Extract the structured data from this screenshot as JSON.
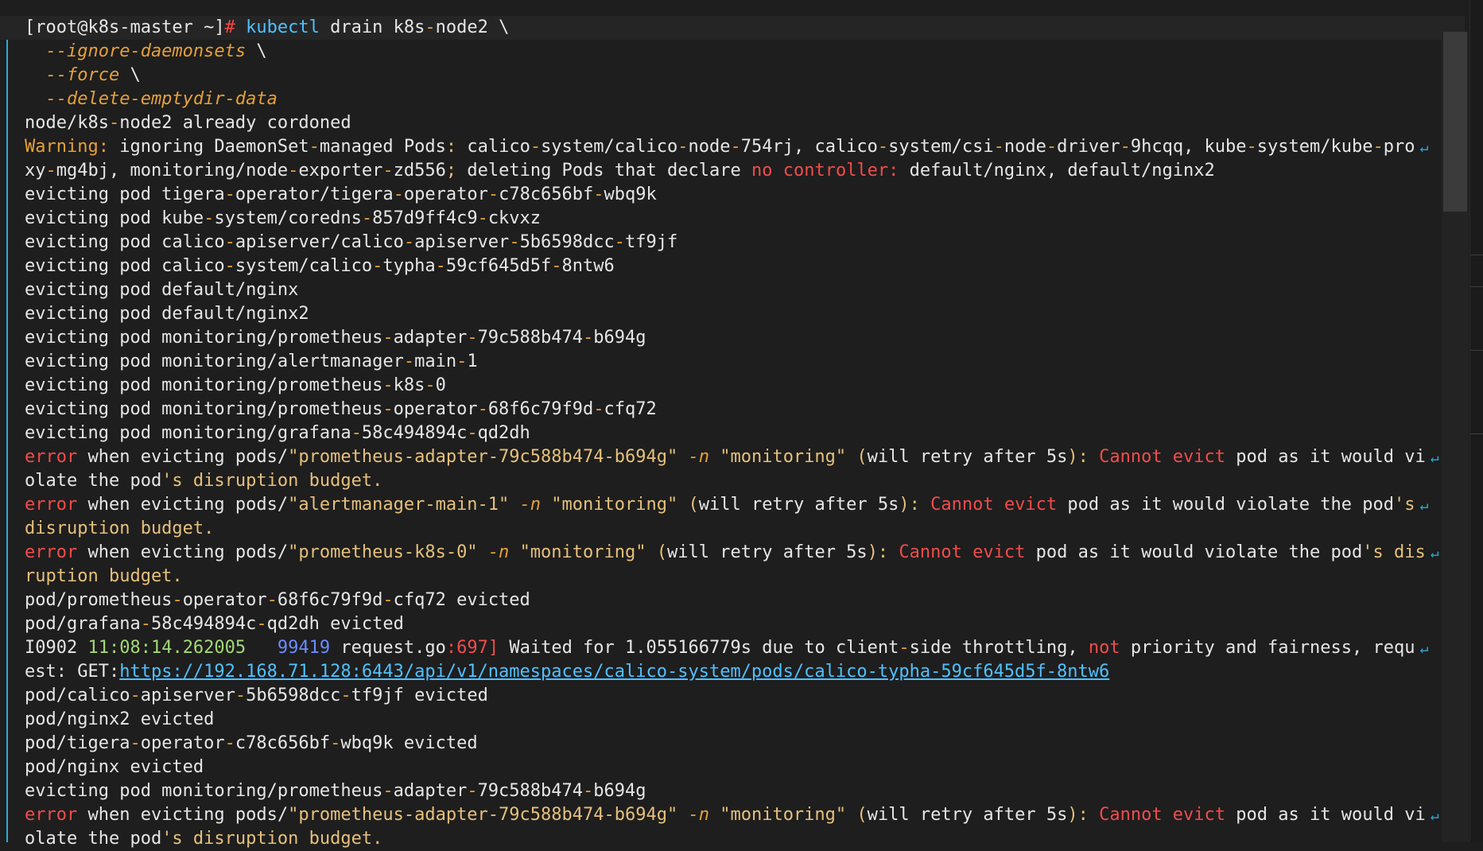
{
  "terminal": {
    "lines": [
      {
        "hl": true,
        "segs": [
          {
            "t": "[root@k8s-master ~]",
            "c": "prompt"
          },
          {
            "t": "# ",
            "c": "hash"
          },
          {
            "t": "kubectl",
            "c": "cmd"
          },
          {
            "t": " drain k8s",
            "c": ""
          },
          {
            "t": "-",
            "c": "dash"
          },
          {
            "t": "node2 \\",
            "c": ""
          }
        ]
      },
      {
        "segs": [
          {
            "t": "  --ignore-daemonsets",
            "c": "flag"
          },
          {
            "t": " \\",
            "c": ""
          }
        ]
      },
      {
        "segs": [
          {
            "t": "  --force",
            "c": "flag"
          },
          {
            "t": " \\",
            "c": ""
          }
        ]
      },
      {
        "segs": [
          {
            "t": "  --delete-emptydir-data",
            "c": "flag"
          }
        ]
      },
      {
        "segs": [
          {
            "t": "node/k8s",
            "c": ""
          },
          {
            "t": "-",
            "c": "dash"
          },
          {
            "t": "node2 already cordoned",
            "c": ""
          }
        ]
      },
      {
        "wrap": true,
        "segs": [
          {
            "t": "Warning:",
            "c": "warn"
          },
          {
            "t": " ignoring DaemonSet",
            "c": ""
          },
          {
            "t": "-",
            "c": "dash"
          },
          {
            "t": "managed Pods",
            "c": ""
          },
          {
            "t": ":",
            "c": "yellow"
          },
          {
            "t": " calico",
            "c": ""
          },
          {
            "t": "-",
            "c": "dash"
          },
          {
            "t": "system/calico",
            "c": ""
          },
          {
            "t": "-",
            "c": "dash"
          },
          {
            "t": "node",
            "c": ""
          },
          {
            "t": "-",
            "c": "dash"
          },
          {
            "t": "754rj, calico",
            "c": ""
          },
          {
            "t": "-",
            "c": "dash"
          },
          {
            "t": "system/csi",
            "c": ""
          },
          {
            "t": "-",
            "c": "dash"
          },
          {
            "t": "node",
            "c": ""
          },
          {
            "t": "-",
            "c": "dash"
          },
          {
            "t": "driver",
            "c": ""
          },
          {
            "t": "-",
            "c": "dash"
          },
          {
            "t": "9hcqq, kube",
            "c": ""
          },
          {
            "t": "-",
            "c": "dash"
          },
          {
            "t": "system/kube",
            "c": ""
          },
          {
            "t": "-",
            "c": "dash"
          },
          {
            "t": "pro",
            "c": ""
          }
        ]
      },
      {
        "segs": [
          {
            "t": "xy",
            "c": ""
          },
          {
            "t": "-",
            "c": "dash"
          },
          {
            "t": "mg4bj, monitoring/node",
            "c": ""
          },
          {
            "t": "-",
            "c": "dash"
          },
          {
            "t": "exporter",
            "c": ""
          },
          {
            "t": "-",
            "c": "dash"
          },
          {
            "t": "zd556",
            "c": ""
          },
          {
            "t": ";",
            "c": "yellow"
          },
          {
            "t": " deleting Pods that declare ",
            "c": ""
          },
          {
            "t": "no controller:",
            "c": "red"
          },
          {
            "t": " default/nginx, default/nginx2",
            "c": ""
          }
        ]
      },
      {
        "segs": [
          {
            "t": "evicting pod tigera",
            "c": ""
          },
          {
            "t": "-",
            "c": "dash"
          },
          {
            "t": "operator/tigera",
            "c": ""
          },
          {
            "t": "-",
            "c": "dash"
          },
          {
            "t": "operator",
            "c": ""
          },
          {
            "t": "-",
            "c": "dash"
          },
          {
            "t": "c78c656bf",
            "c": ""
          },
          {
            "t": "-",
            "c": "dash"
          },
          {
            "t": "wbq9k",
            "c": ""
          }
        ]
      },
      {
        "segs": [
          {
            "t": "evicting pod kube",
            "c": ""
          },
          {
            "t": "-",
            "c": "dash"
          },
          {
            "t": "system/coredns",
            "c": ""
          },
          {
            "t": "-",
            "c": "dash"
          },
          {
            "t": "857d9ff4c9",
            "c": ""
          },
          {
            "t": "-",
            "c": "dash"
          },
          {
            "t": "ckvxz",
            "c": ""
          }
        ]
      },
      {
        "segs": [
          {
            "t": "evicting pod calico",
            "c": ""
          },
          {
            "t": "-",
            "c": "dash"
          },
          {
            "t": "apiserver/calico",
            "c": ""
          },
          {
            "t": "-",
            "c": "dash"
          },
          {
            "t": "apiserver",
            "c": ""
          },
          {
            "t": "-",
            "c": "dash"
          },
          {
            "t": "5b6598dcc",
            "c": ""
          },
          {
            "t": "-",
            "c": "dash"
          },
          {
            "t": "tf9jf",
            "c": ""
          }
        ]
      },
      {
        "segs": [
          {
            "t": "evicting pod calico",
            "c": ""
          },
          {
            "t": "-",
            "c": "dash"
          },
          {
            "t": "system/calico",
            "c": ""
          },
          {
            "t": "-",
            "c": "dash"
          },
          {
            "t": "typha",
            "c": ""
          },
          {
            "t": "-",
            "c": "dash"
          },
          {
            "t": "59cf645d5f",
            "c": ""
          },
          {
            "t": "-",
            "c": "dash"
          },
          {
            "t": "8ntw6",
            "c": ""
          }
        ]
      },
      {
        "segs": [
          {
            "t": "evicting pod default/nginx",
            "c": ""
          }
        ]
      },
      {
        "segs": [
          {
            "t": "evicting pod default/nginx2",
            "c": ""
          }
        ]
      },
      {
        "segs": [
          {
            "t": "evicting pod monitoring/prometheus",
            "c": ""
          },
          {
            "t": "-",
            "c": "dash"
          },
          {
            "t": "adapter",
            "c": ""
          },
          {
            "t": "-",
            "c": "dash"
          },
          {
            "t": "79c588b474",
            "c": ""
          },
          {
            "t": "-",
            "c": "dash"
          },
          {
            "t": "b694g",
            "c": ""
          }
        ]
      },
      {
        "segs": [
          {
            "t": "evicting pod monitoring/alertmanager",
            "c": ""
          },
          {
            "t": "-",
            "c": "dash"
          },
          {
            "t": "main",
            "c": ""
          },
          {
            "t": "-",
            "c": "dash"
          },
          {
            "t": "1",
            "c": ""
          }
        ]
      },
      {
        "segs": [
          {
            "t": "evicting pod monitoring/prometheus",
            "c": ""
          },
          {
            "t": "-",
            "c": "dash"
          },
          {
            "t": "k8s",
            "c": ""
          },
          {
            "t": "-",
            "c": "dash"
          },
          {
            "t": "0",
            "c": ""
          }
        ]
      },
      {
        "segs": [
          {
            "t": "evicting pod monitoring/prometheus",
            "c": ""
          },
          {
            "t": "-",
            "c": "dash"
          },
          {
            "t": "operator",
            "c": ""
          },
          {
            "t": "-",
            "c": "dash"
          },
          {
            "t": "68f6c79f9d",
            "c": ""
          },
          {
            "t": "-",
            "c": "dash"
          },
          {
            "t": "cfq72",
            "c": ""
          }
        ]
      },
      {
        "segs": [
          {
            "t": "evicting pod monitoring/grafana",
            "c": ""
          },
          {
            "t": "-",
            "c": "dash"
          },
          {
            "t": "58c494894c",
            "c": ""
          },
          {
            "t": "-",
            "c": "dash"
          },
          {
            "t": "qd2dh",
            "c": ""
          }
        ]
      },
      {
        "wrap": true,
        "segs": [
          {
            "t": "error",
            "c": "red"
          },
          {
            "t": " when evicting pods/",
            "c": ""
          },
          {
            "t": "\"prometheus-adapter-79c588b474-b694g\"",
            "c": "yellow"
          },
          {
            "t": " ",
            "c": ""
          },
          {
            "t": "-n",
            "c": "flag"
          },
          {
            "t": " ",
            "c": ""
          },
          {
            "t": "\"monitoring\"",
            "c": "yellow"
          },
          {
            "t": " ",
            "c": ""
          },
          {
            "t": "(",
            "c": "yellow"
          },
          {
            "t": "will retry after 5s",
            "c": ""
          },
          {
            "t": "):",
            "c": "yellow"
          },
          {
            "t": " Cannot evict",
            "c": "red"
          },
          {
            "t": " pod as it would vi",
            "c": ""
          }
        ]
      },
      {
        "segs": [
          {
            "t": "olate the pod",
            "c": ""
          },
          {
            "t": "'s disruption budget.",
            "c": "yellow"
          }
        ]
      },
      {
        "wrap": true,
        "segs": [
          {
            "t": "error",
            "c": "red"
          },
          {
            "t": " when evicting pods/",
            "c": ""
          },
          {
            "t": "\"alertmanager-main-1\"",
            "c": "yellow"
          },
          {
            "t": " ",
            "c": ""
          },
          {
            "t": "-n",
            "c": "flag"
          },
          {
            "t": " ",
            "c": ""
          },
          {
            "t": "\"monitoring\"",
            "c": "yellow"
          },
          {
            "t": " ",
            "c": ""
          },
          {
            "t": "(",
            "c": "yellow"
          },
          {
            "t": "will retry after 5s",
            "c": ""
          },
          {
            "t": "):",
            "c": "yellow"
          },
          {
            "t": " Cannot evict",
            "c": "red"
          },
          {
            "t": " pod as it would violate the pod",
            "c": ""
          },
          {
            "t": "'s",
            "c": "yellow"
          }
        ]
      },
      {
        "segs": [
          {
            "t": "disruption budget.",
            "c": "yellow"
          }
        ]
      },
      {
        "wrap": true,
        "segs": [
          {
            "t": "error",
            "c": "red"
          },
          {
            "t": " when evicting pods/",
            "c": ""
          },
          {
            "t": "\"prometheus-k8s-0\"",
            "c": "yellow"
          },
          {
            "t": " ",
            "c": ""
          },
          {
            "t": "-n",
            "c": "flag"
          },
          {
            "t": " ",
            "c": ""
          },
          {
            "t": "\"monitoring\"",
            "c": "yellow"
          },
          {
            "t": " ",
            "c": ""
          },
          {
            "t": "(",
            "c": "yellow"
          },
          {
            "t": "will retry after 5s",
            "c": ""
          },
          {
            "t": "):",
            "c": "yellow"
          },
          {
            "t": " Cannot evict",
            "c": "red"
          },
          {
            "t": " pod as it would violate the pod",
            "c": ""
          },
          {
            "t": "'s dis",
            "c": "yellow"
          }
        ]
      },
      {
        "segs": [
          {
            "t": "ruption budget.",
            "c": "yellow"
          }
        ]
      },
      {
        "segs": [
          {
            "t": "pod/prometheus",
            "c": ""
          },
          {
            "t": "-",
            "c": "dash"
          },
          {
            "t": "operator",
            "c": ""
          },
          {
            "t": "-",
            "c": "dash"
          },
          {
            "t": "68f6c79f9d",
            "c": ""
          },
          {
            "t": "-",
            "c": "dash"
          },
          {
            "t": "cfq72 evicted",
            "c": ""
          }
        ]
      },
      {
        "segs": [
          {
            "t": "pod/grafana",
            "c": ""
          },
          {
            "t": "-",
            "c": "dash"
          },
          {
            "t": "58c494894c",
            "c": ""
          },
          {
            "t": "-",
            "c": "dash"
          },
          {
            "t": "qd2dh evicted",
            "c": ""
          }
        ]
      },
      {
        "wrap": true,
        "segs": [
          {
            "t": "I0902 ",
            "c": ""
          },
          {
            "t": "11:08:14.262005",
            "c": "ts"
          },
          {
            "t": "   ",
            "c": ""
          },
          {
            "t": "99419",
            "c": "blue"
          },
          {
            "t": " request.go",
            "c": ""
          },
          {
            "t": ":697",
            "c": "red"
          },
          {
            "t": "]",
            "c": "red"
          },
          {
            "t": " Waited for 1.055166779s due to client",
            "c": ""
          },
          {
            "t": "-",
            "c": "dash"
          },
          {
            "t": "side throttling, ",
            "c": ""
          },
          {
            "t": "not",
            "c": "red"
          },
          {
            "t": " priority and fairness, requ",
            "c": ""
          }
        ]
      },
      {
        "segs": [
          {
            "t": "est: GET:",
            "c": ""
          },
          {
            "t": "https://192.168.71.128:6443/api/v1/namespaces/calico-system/pods/calico-typha-59cf645d5f-8ntw6",
            "c": "link"
          }
        ]
      },
      {
        "segs": [
          {
            "t": "pod/calico",
            "c": ""
          },
          {
            "t": "-",
            "c": "dash"
          },
          {
            "t": "apiserver",
            "c": ""
          },
          {
            "t": "-",
            "c": "dash"
          },
          {
            "t": "5b6598dcc",
            "c": ""
          },
          {
            "t": "-",
            "c": "dash"
          },
          {
            "t": "tf9jf evicted",
            "c": ""
          }
        ]
      },
      {
        "segs": [
          {
            "t": "pod/nginx2 evicted",
            "c": ""
          }
        ]
      },
      {
        "segs": [
          {
            "t": "pod/tigera",
            "c": ""
          },
          {
            "t": "-",
            "c": "dash"
          },
          {
            "t": "operator",
            "c": ""
          },
          {
            "t": "-",
            "c": "dash"
          },
          {
            "t": "c78c656bf",
            "c": ""
          },
          {
            "t": "-",
            "c": "dash"
          },
          {
            "t": "wbq9k evicted",
            "c": ""
          }
        ]
      },
      {
        "segs": [
          {
            "t": "pod/nginx evicted",
            "c": ""
          }
        ]
      },
      {
        "segs": [
          {
            "t": "evicting pod monitoring/prometheus",
            "c": ""
          },
          {
            "t": "-",
            "c": "dash"
          },
          {
            "t": "adapter",
            "c": ""
          },
          {
            "t": "-",
            "c": "dash"
          },
          {
            "t": "79c588b474",
            "c": ""
          },
          {
            "t": "-",
            "c": "dash"
          },
          {
            "t": "b694g",
            "c": ""
          }
        ]
      },
      {
        "wrap": true,
        "segs": [
          {
            "t": "error",
            "c": "red"
          },
          {
            "t": " when evicting pods/",
            "c": ""
          },
          {
            "t": "\"prometheus-adapter-79c588b474-b694g\"",
            "c": "yellow"
          },
          {
            "t": " ",
            "c": ""
          },
          {
            "t": "-n",
            "c": "flag"
          },
          {
            "t": " ",
            "c": ""
          },
          {
            "t": "\"monitoring\"",
            "c": "yellow"
          },
          {
            "t": " ",
            "c": ""
          },
          {
            "t": "(",
            "c": "yellow"
          },
          {
            "t": "will retry after 5s",
            "c": ""
          },
          {
            "t": "):",
            "c": "yellow"
          },
          {
            "t": " Cannot evict",
            "c": "red"
          },
          {
            "t": " pod as it would vi",
            "c": ""
          }
        ]
      },
      {
        "segs": [
          {
            "t": "olate the pod",
            "c": ""
          },
          {
            "t": "'s disruption budget.",
            "c": "yellow"
          }
        ]
      }
    ],
    "wrap_glyph": "↵",
    "colors": {
      "background": "#1e1e1e",
      "text": "#e6e6e6",
      "command": "#4fc1ff",
      "flag": "#e5a03a",
      "error": "#f14c4c",
      "string": "#e6c07b",
      "link": "#4fc1ff",
      "gutter_accent": "#2fa9d6"
    }
  }
}
